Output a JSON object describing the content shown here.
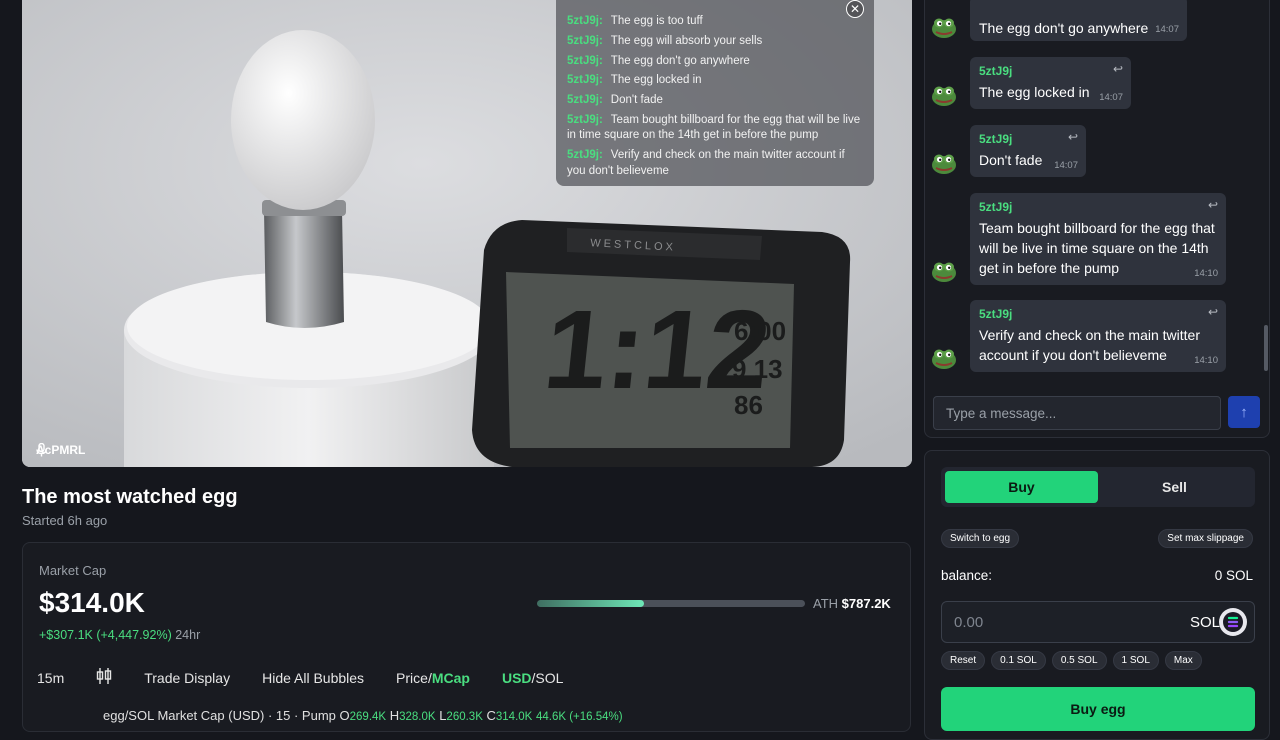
{
  "stream": {
    "streamer": "AcPMRL",
    "overlay_chat": [
      {
        "user": "5ztJ9j:",
        "text": "The egg is too tuff"
      },
      {
        "user": "5ztJ9j:",
        "text": "The egg will absorb your sells"
      },
      {
        "user": "5ztJ9j:",
        "text": "The egg don't go anywhere"
      },
      {
        "user": "5ztJ9j:",
        "text": "The egg locked in"
      },
      {
        "user": "5ztJ9j:",
        "text": "Don't fade"
      },
      {
        "user": "5ztJ9j:",
        "text": "Team bought billboard for the egg that will be live in time square on the 14th get in before the pump"
      },
      {
        "user": "5ztJ9j:",
        "text": "Verify and check on the main twitter account if you don't believeme"
      }
    ]
  },
  "title": "The most watched egg",
  "started": "Started 6h ago",
  "market": {
    "label": "Market Cap",
    "value": "$314.0K",
    "change": "+$307.1K (+4,447.92%)",
    "change_period": "24hr",
    "ath_label": "ATH",
    "ath_value": "$787.2K",
    "ath_progress": 0.4
  },
  "toolbar": {
    "interval": "15m",
    "trade_display": "Trade Display",
    "hide_bubbles": "Hide All Bubbles",
    "price": "Price",
    "slash": "/",
    "mcap": "MCap",
    "usd": "USD",
    "sol": "SOL"
  },
  "chart_header": {
    "title": "egg/SOL Market Cap (USD) · 15 · Pump",
    "o_label": "O",
    "o": "269.4K",
    "h_label": "H",
    "h": "328.0K",
    "l_label": "L",
    "l": "260.3K",
    "c_label": "C",
    "c": "314.0K",
    "chg": "44.6K (+16.54%)"
  },
  "chat": {
    "messages": [
      {
        "user": "5ztJ9j",
        "text": "The egg don't go anywhere",
        "time": "14:07"
      },
      {
        "user": "5ztJ9j",
        "text": "The egg locked in",
        "time": "14:07"
      },
      {
        "user": "5ztJ9j",
        "text": "Don't fade",
        "time": "14:07"
      },
      {
        "user": "5ztJ9j",
        "text": "Team bought billboard for the egg that will be live in time square on the 14th get in before the pump",
        "time": "14:10"
      },
      {
        "user": "5ztJ9j",
        "text": "Verify and check on the main twitter account if you don't believeme",
        "time": "14:10"
      }
    ],
    "placeholder": "Type a message..."
  },
  "trade": {
    "buy_tab": "Buy",
    "sell_tab": "Sell",
    "switch": "Switch to egg",
    "slippage": "Set max slippage",
    "balance_label": "balance:",
    "balance_value": "0 SOL",
    "amount": "0.00",
    "currency": "SOL",
    "quick": [
      "Reset",
      "0.1 SOL",
      "0.5 SOL",
      "1 SOL",
      "Max"
    ],
    "buy_button": "Buy egg"
  },
  "colors": {
    "accent_green": "#22d37a",
    "text_green": "#4ade80",
    "bg": "#15171d"
  }
}
